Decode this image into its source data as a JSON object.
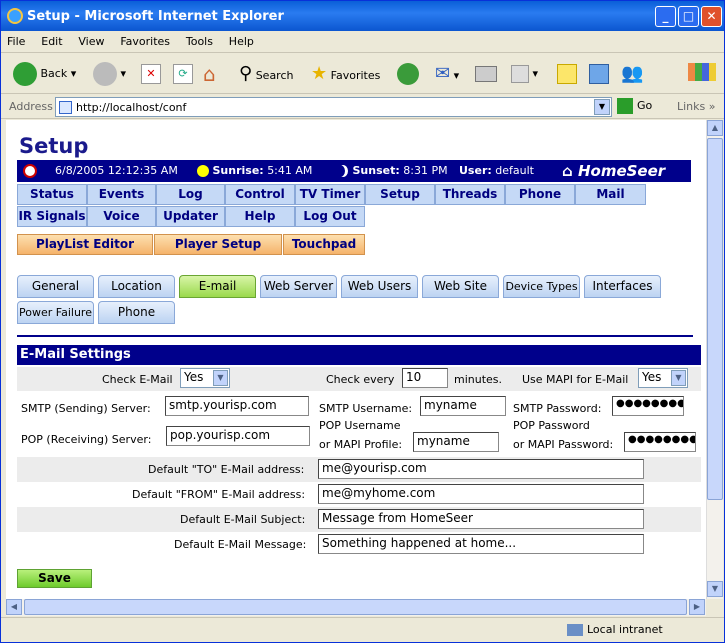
{
  "window": {
    "title": "Setup - Microsoft Internet Explorer",
    "minimize": "_",
    "maximize": "□",
    "close": "✕"
  },
  "menu": [
    "File",
    "Edit",
    "View",
    "Favorites",
    "Tools",
    "Help"
  ],
  "toolbar": {
    "back": "Back",
    "search": "Search",
    "favorites": "Favorites"
  },
  "address": {
    "label": "Address",
    "url": "http://localhost/conf",
    "go": "Go",
    "links": "Links"
  },
  "status": {
    "zone": "Local intranet"
  },
  "page": {
    "title": "Setup",
    "datetime": "6/8/2005 12:12:35 AM",
    "sunrise_label": "Sunrise:",
    "sunrise": "5:41 AM",
    "sunset_label": "Sunset:",
    "sunset": "8:31 PM",
    "user_label": "User:",
    "user": "default",
    "logo": "HomeSeer",
    "nav_row1": [
      "Status",
      "Events",
      "Log",
      "Control",
      "TV Timer",
      "Setup",
      "Threads",
      "Phone",
      "Mail"
    ],
    "nav_row2": [
      "IR Signals",
      "Voice",
      "Updater",
      "Help",
      "Log Out"
    ],
    "nav_orange": [
      "PlayList Editor",
      "Player Setup",
      "Touchpad"
    ],
    "tabs_row1": [
      "General",
      "Location",
      "E-mail",
      "Web Server",
      "Web Users",
      "Web Site",
      "Device Types",
      "Interfaces"
    ],
    "tabs_row2": [
      "Power Failure",
      "Phone"
    ],
    "active_tab": "E-mail",
    "section_title": "E-Mail Settings",
    "form": {
      "check_email_label": "Check E-Mail",
      "check_email_value": "Yes",
      "check_every_label": "Check every",
      "check_every_value": "10",
      "minutes_label": "minutes.",
      "use_mapi_label": "Use MAPI for E-Mail",
      "use_mapi_value": "Yes",
      "smtp_server_label": "SMTP (Sending) Server:",
      "smtp_server_value": "smtp.yourisp.com",
      "smtp_user_label": "SMTP Username:",
      "smtp_user_value": "myname",
      "smtp_pass_label": "SMTP Password:",
      "smtp_pass_value": "●●●●●●●●●",
      "pop_server_label": "POP (Receiving) Server:",
      "pop_server_value": "pop.yourisp.com",
      "pop_user_label1": "POP Username",
      "pop_user_label2": "or MAPI Profile:",
      "pop_user_value": "myname",
      "pop_pass_label1": "POP Password",
      "pop_pass_label2": "or MAPI Password:",
      "pop_pass_value": "●●●●●●●●●",
      "to_label": "Default \"TO\" E-Mail address:",
      "to_value": "me@yourisp.com",
      "from_label": "Default \"FROM\" E-Mail address:",
      "from_value": "me@myhome.com",
      "subject_label": "Default E-Mail Subject:",
      "subject_value": "Message from HomeSeer",
      "message_label": "Default E-Mail Message:",
      "message_value": "Something happened at home..."
    },
    "save": "Save"
  }
}
